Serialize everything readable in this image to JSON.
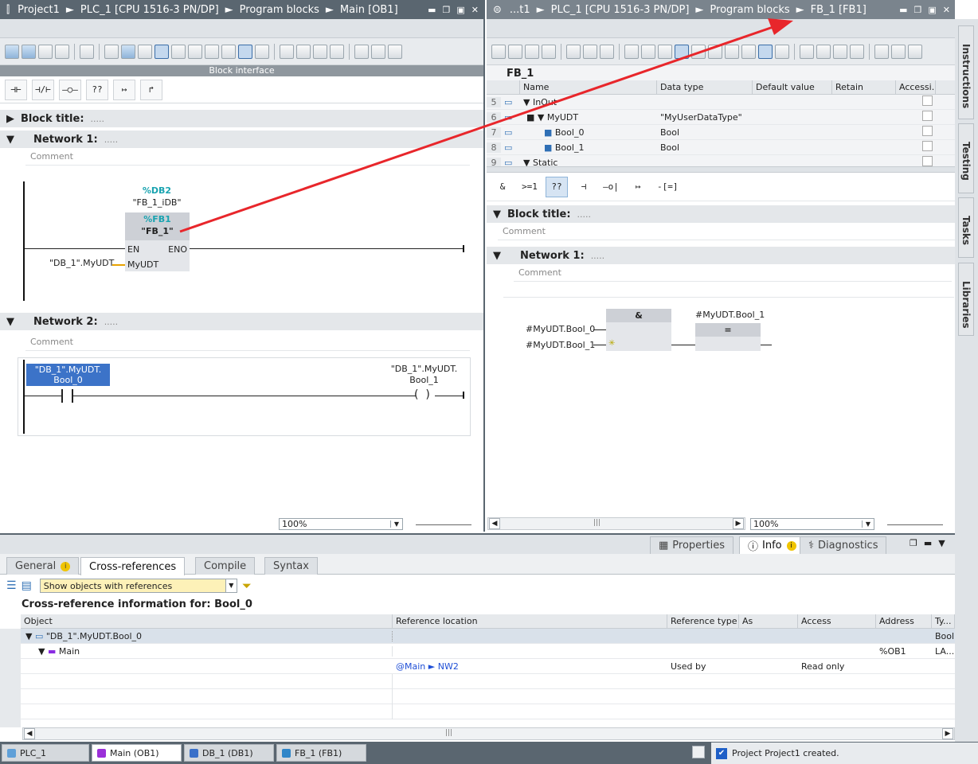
{
  "left_editor": {
    "breadcrumb": [
      "Project1",
      "PLC_1 [CPU 1516-3 PN/DP]",
      "Program blocks",
      "Main [OB1]"
    ],
    "interface_bar": "Block interface",
    "ladder_elements": [
      "⊣⊢",
      "⊣/⊢",
      "–○–",
      "??",
      "↦",
      "↱"
    ],
    "block_title_label": "Block title:",
    "network1": {
      "title": "Network 1:",
      "comment": "Comment",
      "db_addr": "%DB2",
      "db_name": "\"FB_1_iDB\"",
      "fb_addr": "%FB1",
      "fb_name": "\"FB_1\"",
      "pin_en": "EN",
      "pin_eno": "ENO",
      "pin_in": "MyUDT",
      "operand": "\"DB_1\".MyUDT"
    },
    "network2": {
      "title": "Network 2:",
      "comment": "Comment",
      "contact_operand_line1": "\"DB_1\".MyUDT.",
      "contact_operand_line2": "Bool_0",
      "coil_operand_line1": "\"DB_1\".MyUDT.",
      "coil_operand_line2": "Bool_1"
    },
    "zoom": "100%",
    "dots": "....."
  },
  "right_editor": {
    "breadcrumb": [
      "...t1",
      "PLC_1 [CPU 1516-3 PN/DP]",
      "Program blocks",
      "FB_1 [FB1]"
    ],
    "block_name": "FB_1",
    "columns": [
      "Name",
      "Data type",
      "Default value",
      "Retain",
      "Accessi..."
    ],
    "rows": [
      {
        "num": "5",
        "name": "InOut",
        "type": "",
        "indent": 0
      },
      {
        "num": "6",
        "name": "MyUDT",
        "type": "\"MyUserDataType\"",
        "indent": 1
      },
      {
        "num": "7",
        "name": "Bool_0",
        "type": "Bool",
        "indent": 2
      },
      {
        "num": "8",
        "name": "Bool_1",
        "type": "Bool",
        "indent": 2
      },
      {
        "num": "9",
        "name": "Static",
        "type": "",
        "indent": 0
      }
    ],
    "fbd_elements": [
      "&",
      ">=1",
      "??",
      "⊣",
      "–o|",
      "↦",
      "-[=]"
    ],
    "block_title_label": "Block title:",
    "block_title_comment": "Comment",
    "network1": {
      "title": "Network 1:",
      "comment": "Comment",
      "and_label": "&",
      "assign_label": "=",
      "in1": "#MyUDT.Bool_0",
      "in2": "#MyUDT.Bool_1",
      "out": "#MyUDT.Bool_1"
    },
    "zoom": "100%"
  },
  "bottom": {
    "right_tabs": [
      "Properties",
      "Info",
      "Diagnostics"
    ],
    "tabs": [
      "General",
      "Cross-references",
      "Compile",
      "Syntax"
    ],
    "filter_value": "Show objects with references",
    "crossref_title": "Cross-reference information for: Bool_0",
    "columns": [
      "Object",
      "Reference location",
      "Reference type",
      "As",
      "Access",
      "Address",
      "Ty..."
    ],
    "rows": [
      {
        "object": "\"DB_1\".MyUDT.Bool_0",
        "location": "",
        "reftype": "",
        "as": "",
        "access": "",
        "address": "",
        "type": "Bool"
      },
      {
        "object": "Main",
        "location": "",
        "reftype": "",
        "as": "",
        "access": "",
        "address": "%OB1",
        "type": "LA..."
      },
      {
        "object": "",
        "location": "@Main ► NW2",
        "reftype": "Used by",
        "as": "",
        "access": "Read only",
        "address": "",
        "type": ""
      }
    ]
  },
  "side_tabs": [
    "Instructions",
    "Testing",
    "Tasks",
    "Libraries"
  ],
  "taskbar": {
    "items": [
      "PLC_1",
      "Main (OB1)",
      "DB_1 (DB1)",
      "FB_1 (FB1)"
    ],
    "status": "Project Project1 created."
  },
  "colors": {
    "arrow": "#e8262b",
    "selection": "#3c73c8",
    "titlebar": "#5a6670",
    "teal": "#19a3b0"
  }
}
